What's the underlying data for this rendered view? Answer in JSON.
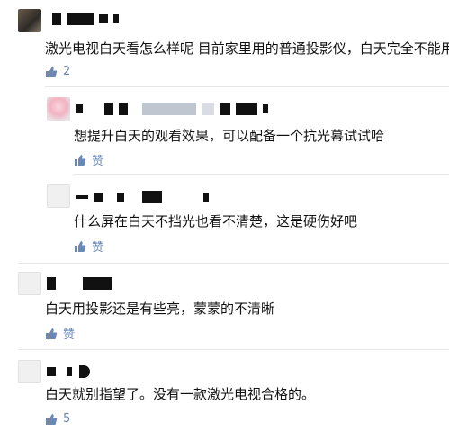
{
  "comments": [
    {
      "text": "激光电视白天看怎么样呢 目前家里用的普通投影仪，白天完全不能用",
      "like": "2"
    },
    {
      "text": "想提升白天的观看效果，可以配备一个抗光幕试试哈",
      "like": "赞"
    },
    {
      "text": "什么屏在白天不挡光也看不清楚，这是硬伤好吧",
      "like": "赞"
    },
    {
      "text": "白天用投影还是有些亮，蒙蒙的不清晰",
      "like": "赞"
    },
    {
      "text": "白天就别指望了。没有一款激光电视合格的。",
      "like": "5"
    }
  ],
  "colors": {
    "like_blue": "#6a87b8",
    "divider": "#e8e8e8"
  },
  "icons": {
    "like": "thumbs-up-icon"
  }
}
